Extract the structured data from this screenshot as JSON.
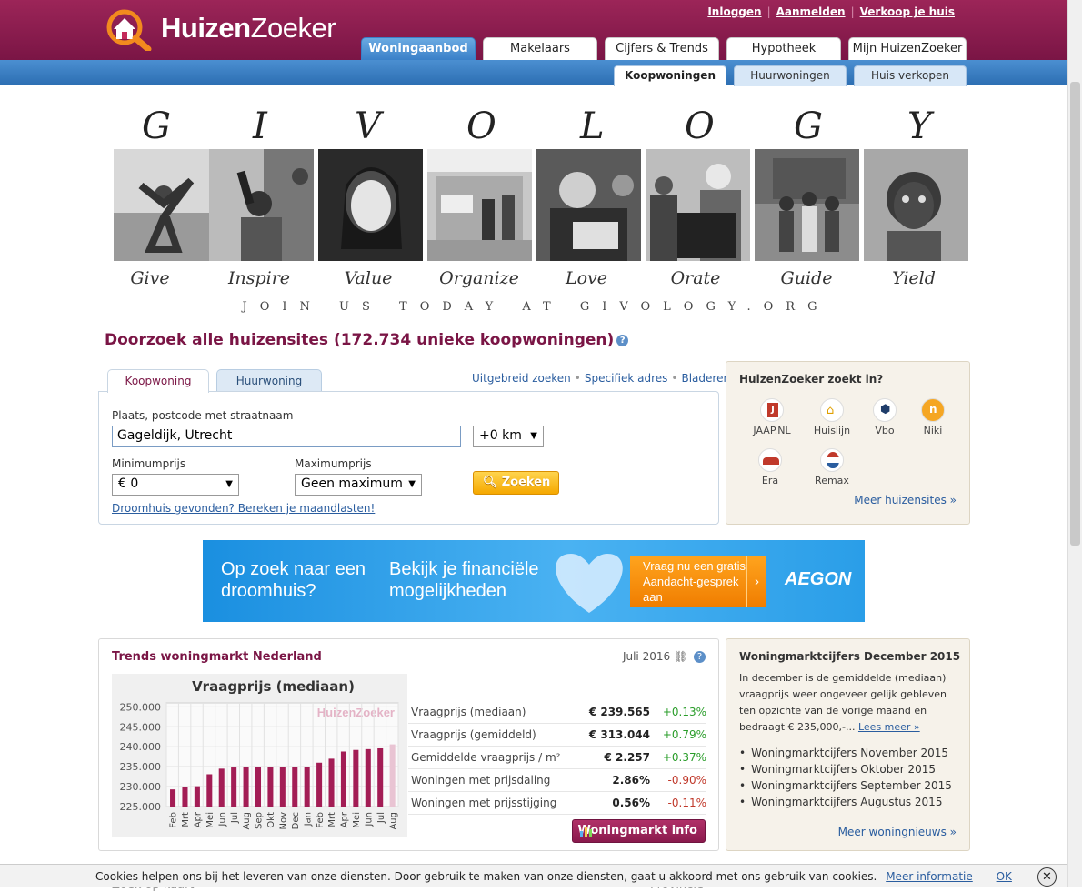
{
  "header": {
    "logo_bold": "Huizen",
    "logo_light": "Zoeker",
    "links": [
      "Inloggen",
      "Aanmelden",
      "Verkoop je huis"
    ],
    "main_tabs": [
      "Woningaanbod",
      "Makelaars",
      "Cijfers & Trends",
      "Hypotheek",
      "Mijn HuizenZoeker"
    ],
    "sub_tabs": [
      "Koopwoningen",
      "Huurwoningen",
      "Huis verkopen"
    ]
  },
  "givology": {
    "letters": [
      "G",
      "I",
      "V",
      "O",
      "L",
      "O",
      "G",
      "Y"
    ],
    "words": [
      "Give",
      "Inspire",
      "Value",
      "Organize",
      "Love",
      "Orate",
      "Guide",
      "Yield"
    ],
    "footer": "JOIN US TODAY AT GIVOLOGY.ORG"
  },
  "headline": "Doorzoek alle huizensites (172.734 unieke koopwoningen)",
  "search": {
    "tabs": [
      "Koopwoning",
      "Huurwoning"
    ],
    "links": [
      "Uitgebreid zoeken",
      "Specifiek adres",
      "Bladeren"
    ],
    "place_label": "Plaats, postcode met straatnaam",
    "place_value": "Gageldijk, Utrecht",
    "radius": "+0 km",
    "min_label": "Minimumprijs",
    "min_value": "€ 0",
    "max_label": "Maximumprijs",
    "max_value": "Geen maximum",
    "submit": "Zoeken",
    "dream_link": "Droomhuis gevonden? Bereken je maandlasten!"
  },
  "sites": {
    "title": "HuizenZoeker zoekt in?",
    "items": [
      "JAAP.NL",
      "Huislijn",
      "Vbo",
      "Niki",
      "Era",
      "Remax"
    ],
    "more": "Meer huizensites »"
  },
  "ad": {
    "line1": "Op zoek naar een",
    "line2": "droomhuis?",
    "line3": "Bekijk je financiële",
    "line4": "mogelijkheden",
    "cta": "Vraag nu een gratis Aandacht-gesprek aan",
    "brand": "AEGON"
  },
  "trends": {
    "title": "Trends woningmarkt Nederland",
    "date": "Juli 2016",
    "rows": [
      {
        "label": "Vraagprijs (mediaan)",
        "value": "€ 239.565",
        "change": "+0.13%"
      },
      {
        "label": "Vraagprijs (gemiddeld)",
        "value": "€ 313.044",
        "change": "+0.79%"
      },
      {
        "label": "Gemiddelde vraagprijs / m²",
        "value": "€ 2.257",
        "change": "+0.37%"
      },
      {
        "label": "Woningen met prijsdaling",
        "value": "2.86%",
        "change": "-0.90%"
      },
      {
        "label": "Woningen met prijsstijging",
        "value": "0.56%",
        "change": "-0.11%"
      }
    ],
    "button": "Woningmarkt info"
  },
  "chart_data": {
    "type": "bar",
    "title": "Vraagprijs (mediaan)",
    "watermark": "HuizenZoeker",
    "categories": [
      "Feb",
      "Mrt",
      "Apr",
      "Mei",
      "Jun",
      "Jul",
      "Aug",
      "Sep",
      "Okt",
      "Nov",
      "Dec",
      "Jan",
      "Feb",
      "Mrt",
      "Apr",
      "Mei",
      "Jun",
      "Jul",
      "Aug"
    ],
    "values": [
      229.3,
      229.8,
      230.1,
      233.1,
      234.5,
      234.8,
      234.9,
      235.0,
      234.9,
      234.9,
      234.9,
      234.9,
      236.0,
      237.0,
      238.8,
      239.2,
      239.4,
      239.6,
      240.6
    ],
    "highlight_last": true,
    "ylim": [
      225,
      251
    ],
    "yticks": [
      "225.000",
      "230.000",
      "235.000",
      "240.000",
      "245.000",
      "250.000"
    ],
    "grid": true,
    "colors": {
      "bar": "#a31d55",
      "last_bar": "#e9c4d3"
    }
  },
  "news": {
    "title": "Woningmarktcijfers December 2015",
    "text": "In december is de gemiddelde (mediaan) vraagprijs weer ongeveer gelijk gebleven ten opzichte van de vorige maand en bedraagt € 235,000,-...",
    "read_more": "Lees meer »",
    "items": [
      "Woningmarktcijfers November 2015",
      "Woningmarktcijfers Oktober 2015",
      "Woningmarktcijfers September 2015",
      "Woningmarktcijfers Augustus 2015"
    ],
    "more": "Meer woningnieuws »"
  },
  "cookie": {
    "text": "Cookies helpen ons bij het leveren van onze diensten. Door gebruik te maken van onze diensten, gaat u akkoord met ons gebruik van cookies.",
    "more": "Meer informatie",
    "ok": "OK",
    "close": "✕"
  },
  "peek": {
    "left": "Zoek op kaart",
    "right": "Provincie"
  }
}
